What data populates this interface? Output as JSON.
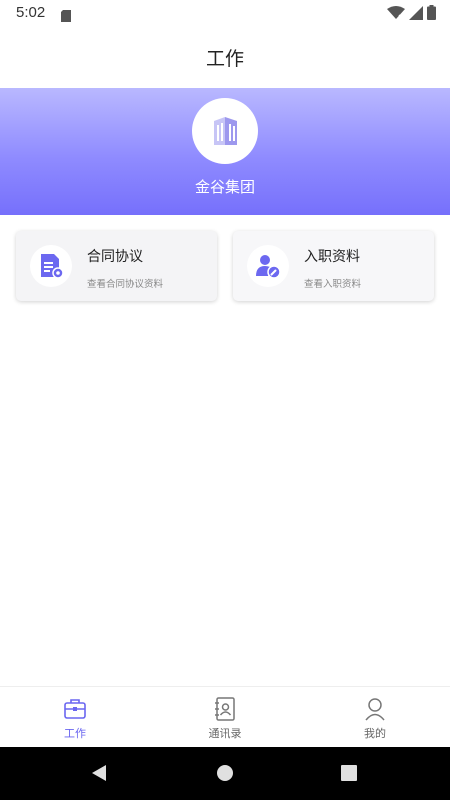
{
  "status_bar": {
    "time": "5:02"
  },
  "header": {
    "title": "工作"
  },
  "banner": {
    "company_name": "金谷集团"
  },
  "cards": [
    {
      "title": "合同协议",
      "subtitle": "查看合同协议资料",
      "icon": "contract-document-icon"
    },
    {
      "title": "入职资料",
      "subtitle": "查看入职资料",
      "icon": "user-edit-icon"
    }
  ],
  "tabbar": {
    "items": [
      {
        "label": "工作",
        "icon": "briefcase-icon",
        "active": true
      },
      {
        "label": "通讯录",
        "icon": "contacts-book-icon",
        "active": false
      },
      {
        "label": "我的",
        "icon": "person-icon",
        "active": false
      }
    ]
  },
  "colors": {
    "accent": "#6a66f0",
    "banner_top": "#b9b8ff",
    "banner_bottom": "#7670fb"
  }
}
